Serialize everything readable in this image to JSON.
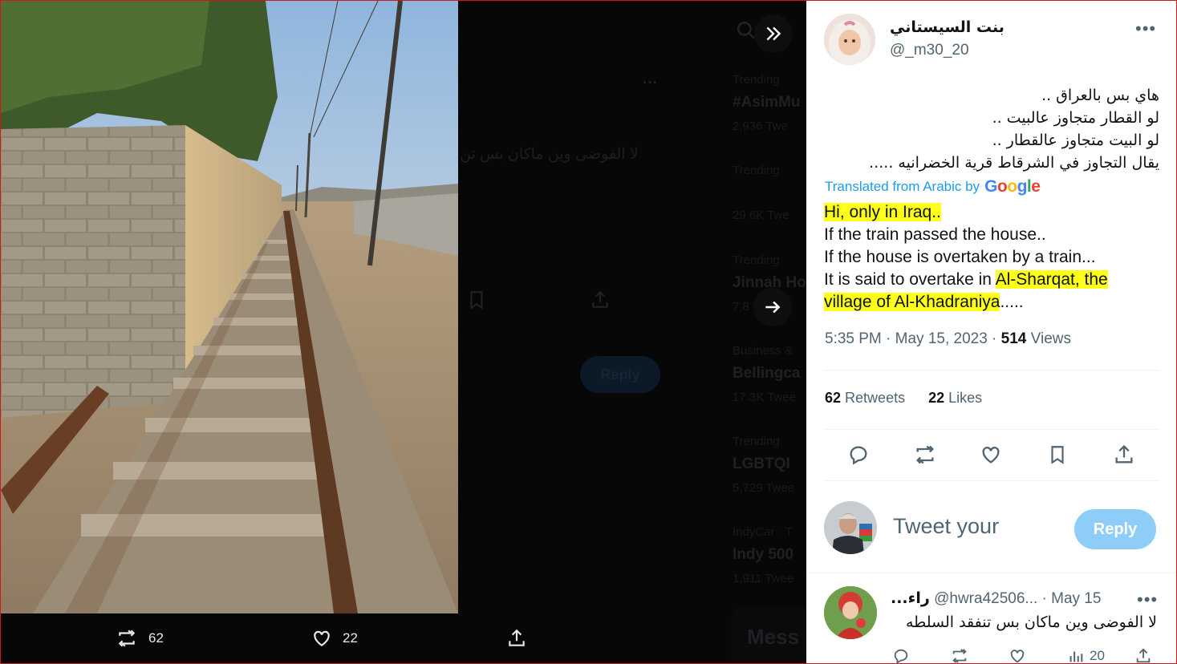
{
  "background_timeline": {
    "tweet_text": "لا الفوضى وين ماكان بس تن",
    "trends": [
      {
        "category": "Trending",
        "name": "#AsimMu",
        "count": "2,936 Twe"
      },
      {
        "category": "Trending",
        "name": "",
        "count": "29.6K Twe"
      },
      {
        "category": "Trending",
        "name": "Jinnah Ho",
        "count": "7,8"
      },
      {
        "category": "Business &",
        "name": "Bellingca",
        "count": "17.3K Twee"
      },
      {
        "category": "Trending",
        "name": "LGBTQI",
        "count": "5,729 Twee"
      },
      {
        "category": "IndyCar · T",
        "name": "Indy 500",
        "count": "1,911 Twee"
      }
    ],
    "reply_label": "Reply",
    "messages_label": "Mess"
  },
  "media_actions": {
    "retweets": "62",
    "likes": "22"
  },
  "tweet": {
    "author_name": "بنت السيستاني",
    "author_handle": "@_m30_20",
    "arabic_lines": [
      "هاي بس بالعراق ..",
      "لو القطار متجاوز عالبيت ..",
      "لو البيت متجاوز عالقطار ..",
      "يقال التجاوز في الشرقاط قرية الخضرانيه ....."
    ],
    "translated_from": "Translated from Arabic by",
    "translation_provider": "Google",
    "translation": {
      "line1": "Hi, only in Iraq..",
      "line2": "If the train passed the house..",
      "line3": "If the house is overtaken by a train...",
      "line4_prefix": "It is said to overtake in ",
      "line4_highlight": "Al-Sharqat, the",
      "line5_highlight": "village of Al-Khadraniya",
      "line5_suffix": "....."
    },
    "time": "5:35 PM · May 15, 2023 ·",
    "views_count": "514",
    "views_label": "Views",
    "retweets_count": "62",
    "retweets_label": "Retweets",
    "likes_count": "22",
    "likes_label": "Likes"
  },
  "compose": {
    "placeholder": "Tweet your",
    "reply_label": "Reply"
  },
  "reply": {
    "name": "...راء",
    "handle": "@hwra42506...",
    "date": "· May 15",
    "text": "لا الفوضى وين ماكان بس تنفقد السلطه",
    "views": "20"
  },
  "colors": {
    "accent": "#1d9bf0",
    "highlight": "#ffff1a",
    "reply_button_disabled": "#8ecdf8"
  }
}
